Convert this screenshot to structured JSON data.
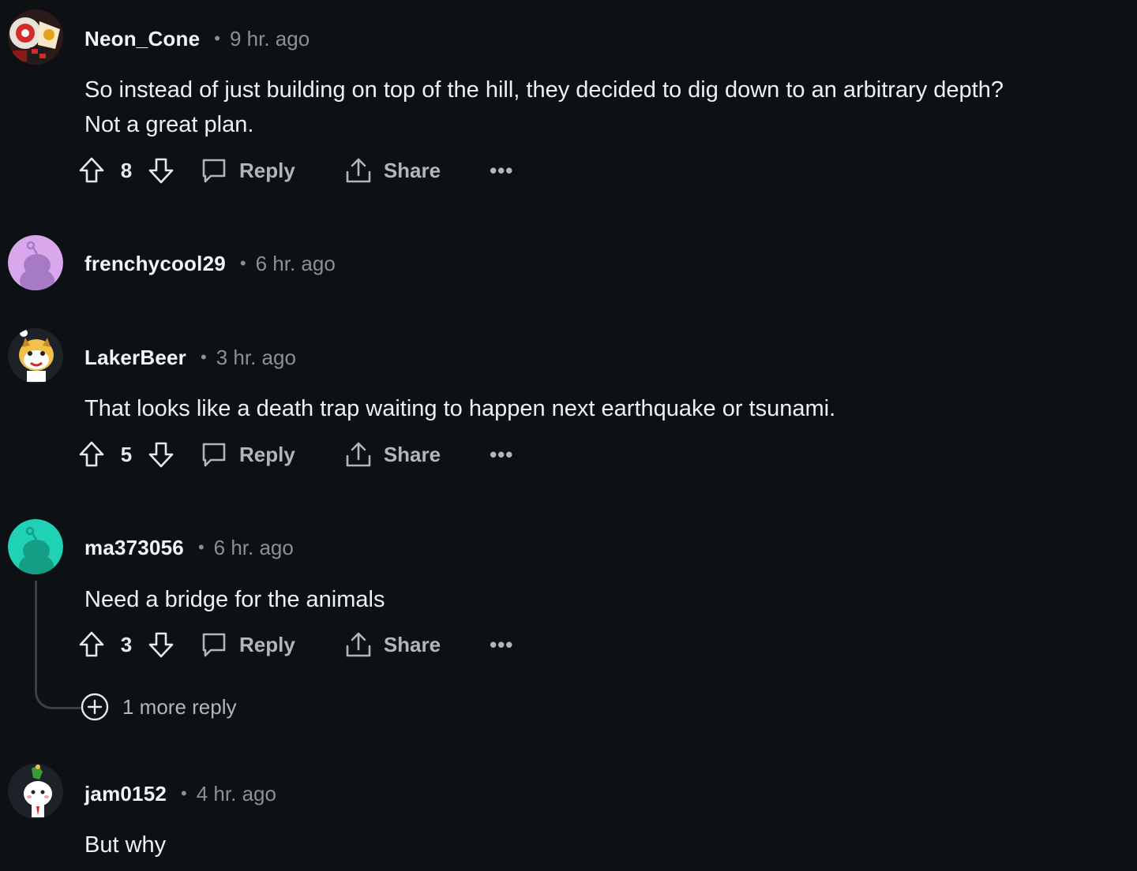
{
  "comments": [
    {
      "username": "Neon_Cone",
      "separator": "•",
      "time": "9 hr. ago",
      "text_lines": [
        "So instead of just building on top of the hill, they decided to dig down to an arbitrary depth?",
        "Not a great plan."
      ],
      "score": "8",
      "reply_label": "Reply",
      "share_label": "Share",
      "more_label": "•••"
    },
    {
      "username": "frenchycool29",
      "separator": "•",
      "time": "6 hr. ago"
    },
    {
      "username": "LakerBeer",
      "separator": "•",
      "time": "3 hr. ago",
      "text_lines": [
        "That looks like a death trap waiting to happen next earthquake or tsunami."
      ],
      "score": "5",
      "reply_label": "Reply",
      "share_label": "Share",
      "more_label": "•••"
    },
    {
      "username": "ma373056",
      "separator": "•",
      "time": "6 hr. ago",
      "text_lines": [
        "Need a bridge for the animals"
      ],
      "score": "3",
      "reply_label": "Reply",
      "share_label": "Share",
      "more_label": "•••",
      "more_replies_label": "1 more reply"
    },
    {
      "username": "jam0152",
      "separator": "•",
      "time": "4 hr. ago",
      "text_lines": [
        "But why"
      ]
    }
  ],
  "icons": {
    "upvote": "upvote-arrow-icon",
    "downvote": "downvote-arrow-icon",
    "reply": "comment-bubble-icon",
    "share": "share-upload-icon",
    "more": "ellipsis-icon",
    "expand": "plus-circle-icon"
  },
  "colors": {
    "background": "#0e1113",
    "muted_text": "#8a9196",
    "action_text": "#b0b7bb",
    "avatar_frenchycool29": "#d9a8ec",
    "avatar_ma373056": "#1fd1b5"
  }
}
